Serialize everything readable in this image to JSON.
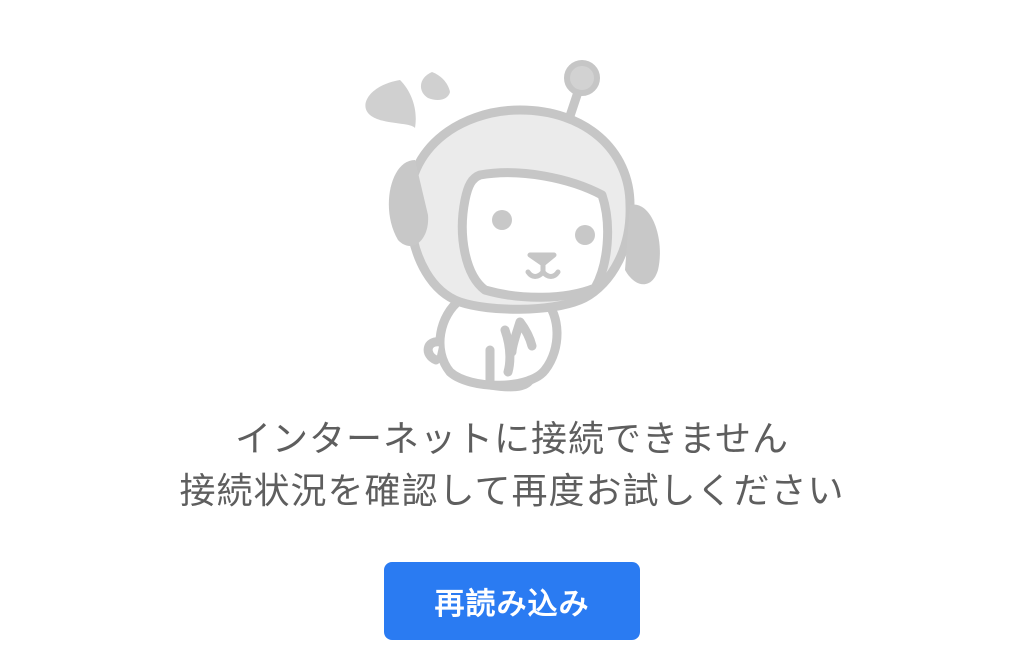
{
  "error": {
    "illustration_icon": "confused-dog-mascot-icon",
    "message_line1": "インターネットに接続できません",
    "message_line2": "接続状況を確認して再度お試しください"
  },
  "reload_button": {
    "label": "再読み込み",
    "color": "#2a7bf2"
  },
  "colors": {
    "text": "#5e5e5e",
    "illustration_stroke": "#c4c4c4",
    "illustration_fill": "#ebebeb"
  }
}
